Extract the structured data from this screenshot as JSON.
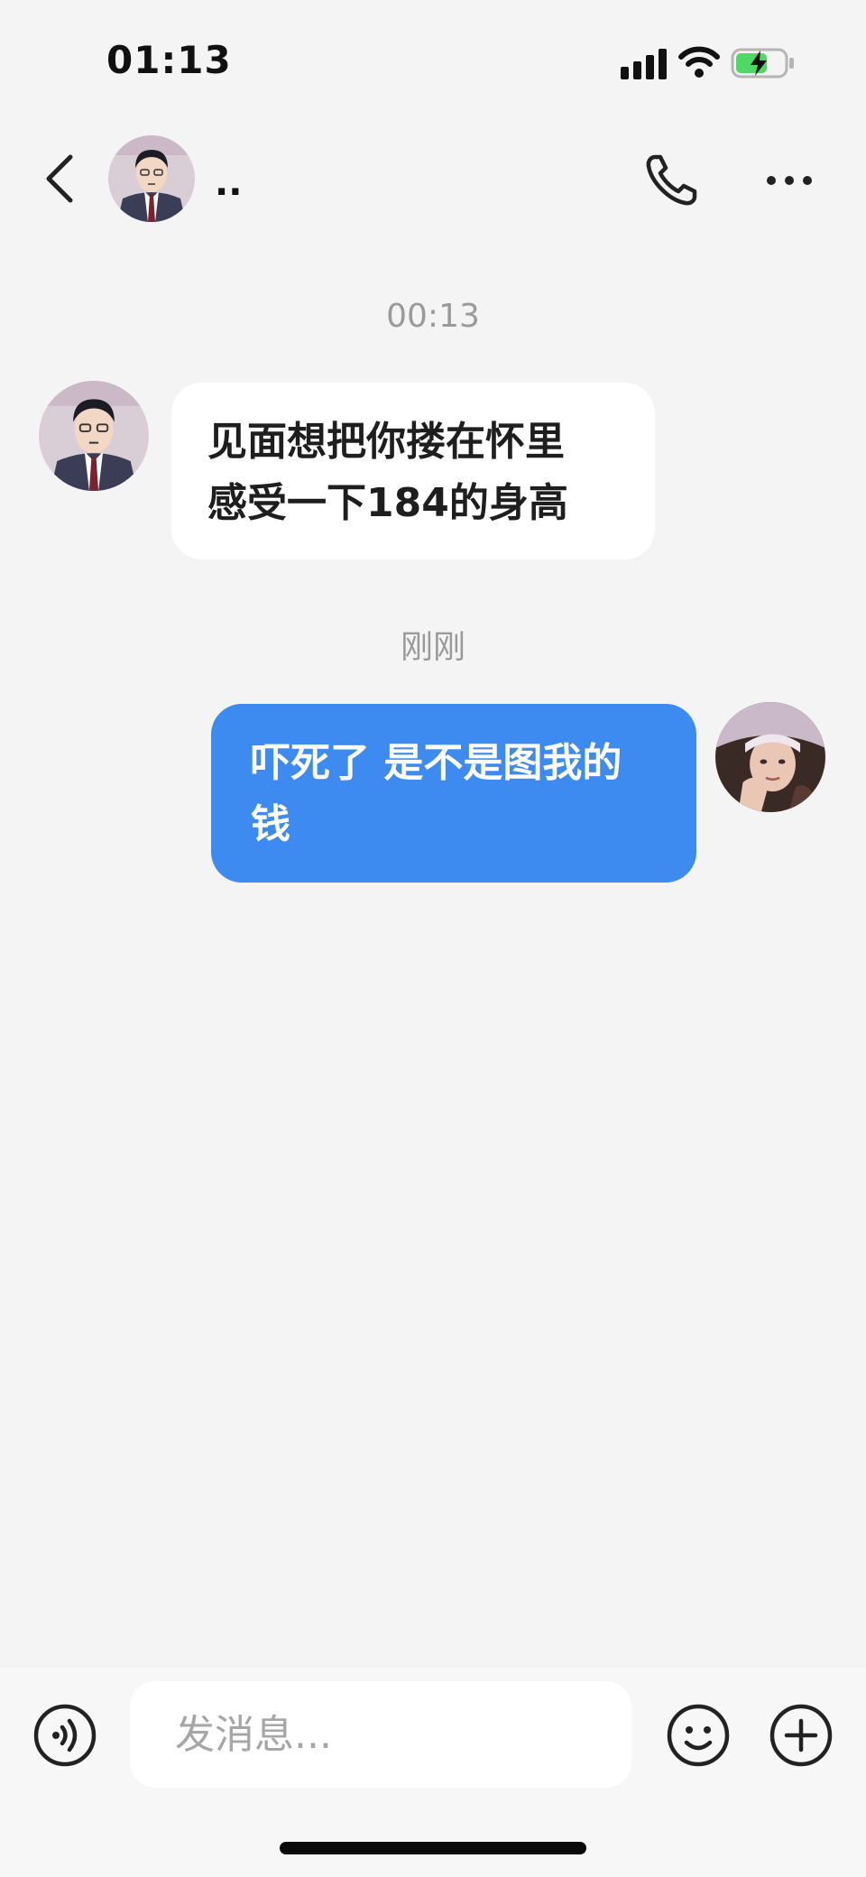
{
  "status_bar": {
    "time": "01:13",
    "icons": [
      "signal-icon",
      "wifi-icon",
      "battery-charging-icon"
    ],
    "battery_color": "#4cd964"
  },
  "header": {
    "contact_name": "..",
    "icons": [
      "back-chevron-icon",
      "phone-icon",
      "more-dots-icon"
    ]
  },
  "messages": [
    {
      "timestamp": "00:13",
      "sender": "contact",
      "lines": [
        "见面想把你搂在怀里",
        "感受一下184的身高"
      ]
    },
    {
      "timestamp": "刚刚",
      "sender": "self",
      "lines": [
        "吓死了 是不是图我的",
        "钱"
      ]
    }
  ],
  "input_bar": {
    "placeholder": "发消息...",
    "icons": [
      "voice-icon",
      "emoji-icon",
      "plus-icon"
    ]
  },
  "colors": {
    "background": "#f4f4f4",
    "outgoing_bubble": "#3d8af0",
    "incoming_bubble": "#ffffff",
    "timestamp_text": "#9a9a9a"
  }
}
